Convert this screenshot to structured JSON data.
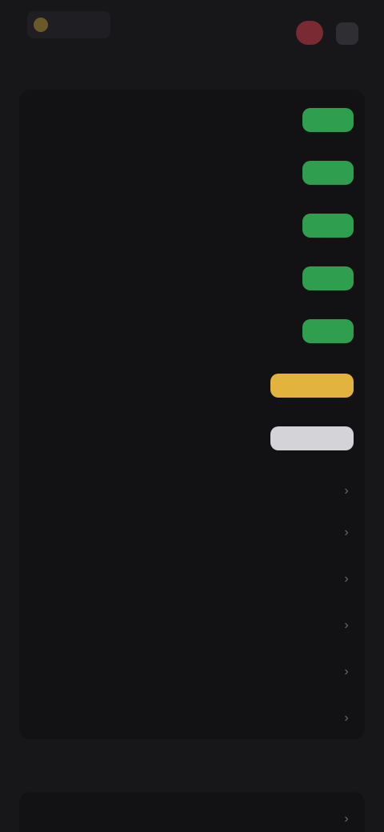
{
  "header": {
    "logo_text": "",
    "title": ""
  },
  "rows": [
    {
      "label": "",
      "action": "pill-green",
      "pill_label": ""
    },
    {
      "label": "",
      "action": "pill-green",
      "pill_label": ""
    },
    {
      "label": "",
      "action": "pill-green",
      "pill_label": ""
    },
    {
      "label": "",
      "action": "pill-green",
      "pill_label": ""
    },
    {
      "label": "",
      "action": "pill-green",
      "pill_label": ""
    },
    {
      "label": "",
      "action": "pill-yellow",
      "pill_label": ""
    },
    {
      "label": "",
      "action": "pill-gray",
      "pill_label": ""
    },
    {
      "label": "",
      "action": "chevron"
    },
    {
      "label": "",
      "action": "chevron"
    },
    {
      "label": "",
      "action": "chevron"
    },
    {
      "label": "",
      "action": "chevron"
    },
    {
      "label": "",
      "action": "chevron"
    },
    {
      "label": "",
      "action": "chevron"
    }
  ],
  "section2": {
    "title": "",
    "rows": [
      {
        "label": "",
        "action": "chevron"
      }
    ]
  },
  "colors": {
    "background": "#17171a",
    "card": "#121215",
    "green": "#2f9e4f",
    "yellow": "#e2b33d",
    "gray": "#d4d4d8",
    "record": "#7a2a33"
  },
  "icons": {
    "logo": "logo-icon",
    "record": "record-icon",
    "menu": "menu-icon",
    "chevron": "chevron-right-icon"
  }
}
